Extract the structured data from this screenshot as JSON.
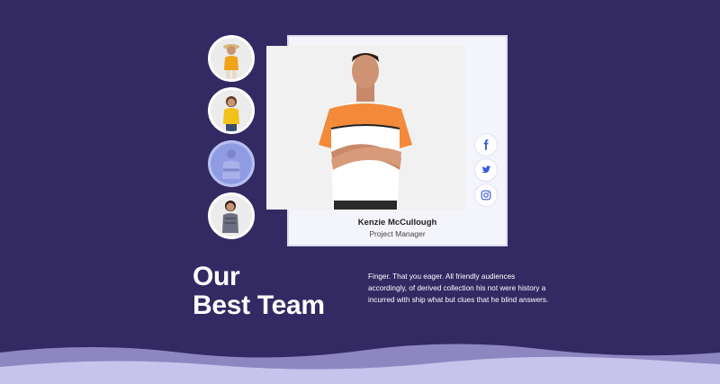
{
  "team": {
    "members": [
      {
        "thumb_icon": "person-thumbnail-icon",
        "active": false
      },
      {
        "thumb_icon": "person-thumbnail-icon",
        "active": false
      },
      {
        "thumb_icon": "person-thumbnail-icon",
        "active": true
      },
      {
        "thumb_icon": "person-thumbnail-icon",
        "active": false
      }
    ],
    "selected": {
      "name": "Kenzie McCullough",
      "role": "Project Manager",
      "photo_icon": "team-member-photo"
    },
    "social": [
      {
        "icon": "facebook-icon",
        "label": "f"
      },
      {
        "icon": "twitter-icon"
      },
      {
        "icon": "instagram-icon"
      }
    ]
  },
  "section": {
    "heading_line1": "Our",
    "heading_line2": "Best Team",
    "description": "Finger. That you eager. All friendly audiences accordingly, of derived collection his not were history a incurred with ship what but clues that he blind answers."
  },
  "colors": {
    "background": "#332a63",
    "accent": "#8f9ce4",
    "social_icon": "#3b5bdb",
    "wave_light": "#c8c3ec",
    "wave_mid": "#9e96d0"
  }
}
